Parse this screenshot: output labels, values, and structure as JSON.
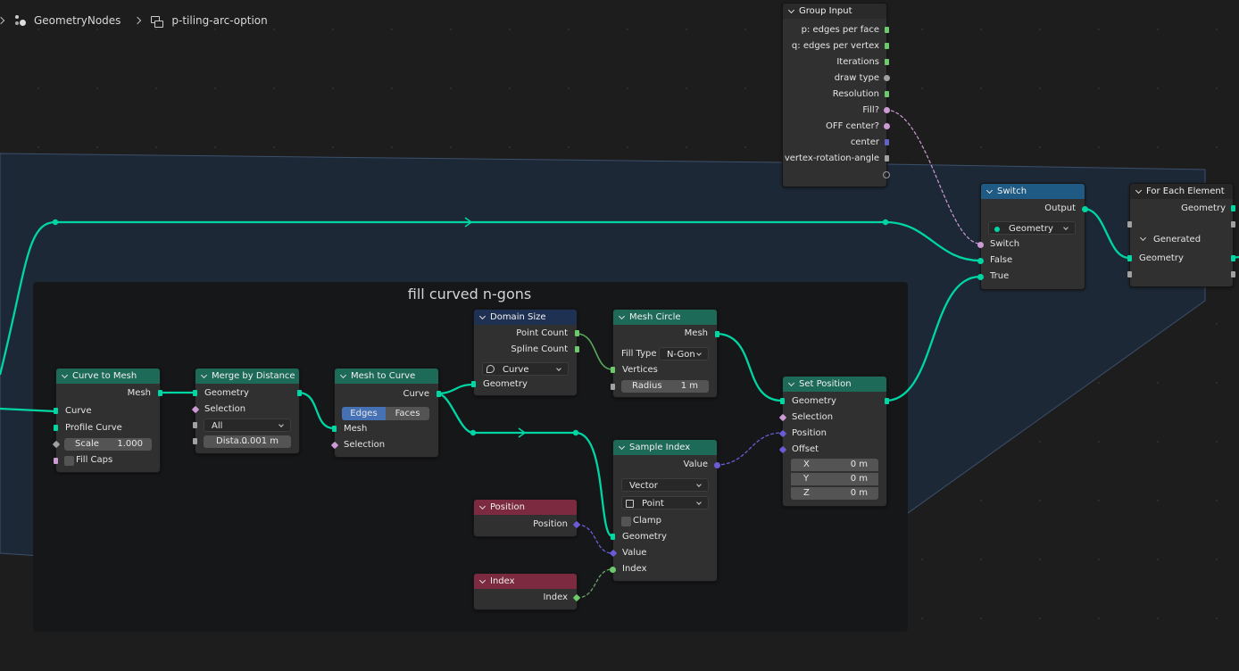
{
  "breadcrumb": {
    "item1": "GeometryNodes",
    "item2": "p-tiling-arc-option"
  },
  "frame": {
    "label": "fill curved n-gons"
  },
  "nodes": {
    "group_input": {
      "title": "Group Input",
      "outputs": [
        "p: edges per face",
        "q: edges per vertex",
        "Iterations",
        "draw type",
        "Resolution",
        "Fill?",
        "OFF center?",
        "center",
        "vertex-rotation-angle"
      ]
    },
    "switch": {
      "title": "Switch",
      "output": "Output",
      "type": "Geometry",
      "inputs": [
        "Switch",
        "False",
        "True"
      ]
    },
    "for_each": {
      "title": "For Each Element",
      "geometry_out": "Geometry",
      "panel": "Generated",
      "geometry_in": "Geometry"
    },
    "curve_to_mesh": {
      "title": "Curve to Mesh",
      "output": "Mesh",
      "curve": "Curve",
      "profile": "Profile Curve",
      "scale_label": "Scale",
      "scale_value": "1.000",
      "fill_caps": "Fill Caps"
    },
    "merge": {
      "title": "Merge by Distance",
      "geometry": "Geometry",
      "selection": "Selection",
      "mode": "All",
      "dist_label": "Dista...",
      "dist_value": "0.001 m"
    },
    "mesh_to_curve": {
      "title": "Mesh to Curve",
      "output": "Curve",
      "mode_edges": "Edges",
      "mode_faces": "Faces",
      "mesh": "Mesh",
      "selection": "Selection"
    },
    "domain_size": {
      "title": "Domain Size",
      "point_count": "Point Count",
      "spline_count": "Spline Count",
      "type": "Curve",
      "geometry": "Geometry"
    },
    "mesh_circle": {
      "title": "Mesh Circle",
      "output": "Mesh",
      "fill_type_label": "Fill Type",
      "fill_type": "N-Gon",
      "vertices": "Vertices",
      "radius_label": "Radius",
      "radius_value": "1 m"
    },
    "set_position": {
      "title": "Set Position",
      "geometry": "Geometry",
      "selection": "Selection",
      "position": "Position",
      "offset": "Offset",
      "x_label": "X",
      "x_value": "0 m",
      "y_label": "Y",
      "y_value": "0 m",
      "z_label": "Z",
      "z_value": "0 m"
    },
    "sample_index": {
      "title": "Sample Index",
      "output": "Value",
      "data_type": "Vector",
      "domain": "Point",
      "clamp": "Clamp",
      "geometry": "Geometry",
      "value": "Value",
      "index": "Index"
    },
    "position": {
      "title": "Position",
      "output": "Position"
    },
    "index": {
      "title": "Index",
      "output": "Index"
    }
  },
  "colors": {
    "geometry_wire": "#00d6a3",
    "geometry_header": "#1e6a58",
    "input_header": "#7b2a3f",
    "switch_header": "#1f5a84",
    "converter_header": "#1f3153"
  }
}
